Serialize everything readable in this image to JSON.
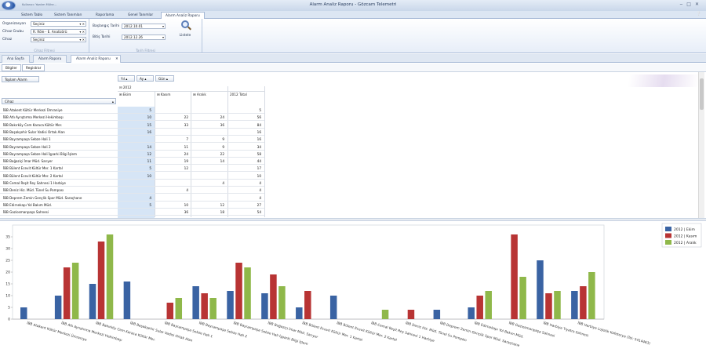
{
  "app": {
    "title": "Alarm Analiz Raporu - Gözcam Telemetri",
    "quick_access": "Kullanıcı: Yazılım Mühe..."
  },
  "ribbon_tabs": [
    "Sistem Tablo",
    "Sistem Tanımları",
    "Raporlama",
    "Genel Tanımlar",
    "Alarm Analiz Raporu"
  ],
  "filters": {
    "organization_label": "Organizasyon",
    "organization_value": "Seçiniz",
    "device_group_label": "Cihaz Grubu",
    "device_group_value": "R. Röle - E. Analizörü",
    "device_label": "Cihaz",
    "device_value": "Seçiniz",
    "group_caption": "Cihaz Filtresi"
  },
  "date_filters": {
    "start_label": "Başlangıç Tarihi",
    "start_value": "2012.10.01",
    "end_label": "Bitiş Tarihi",
    "end_value": "2012.12.26",
    "group_caption": "Tarih Filtresi"
  },
  "list_button": "Listele",
  "doc_tabs": [
    "Ana Sayfa",
    "Alarm Raporu",
    "Alarm Analiz Raporu"
  ],
  "sub_tabs": [
    "Bilgiler",
    "Registrar"
  ],
  "pivot": {
    "data_field": "Toplam Alarm",
    "column_fields": [
      "Yıl",
      "Ay",
      "Gün"
    ],
    "row_field": "Cihaz",
    "year": "2012",
    "months": [
      "Ekim",
      "Kasım",
      "Aralık"
    ],
    "total_label": "2012 Total",
    "rows": [
      {
        "name": "İBB Atakent Kültür Merkezi Ümraniye",
        "v": [
          "5",
          "",
          "",
          "5"
        ]
      },
      {
        "name": "İBB Atlı Ayrıştırma Merkezi Hekimbaşı",
        "v": [
          "10",
          "22",
          "24",
          "56"
        ]
      },
      {
        "name": "İBB Bakırköy Cem Karaca Kültür Mer.",
        "v": [
          "15",
          "33",
          "36",
          "84"
        ]
      },
      {
        "name": "İBB Başakşehir Sular Vadisi Ortak Alan",
        "v": [
          "16",
          "",
          "",
          "16"
        ]
      },
      {
        "name": "İBB Bayrampaşa Sebze Hali 1",
        "v": [
          "",
          "7",
          "9",
          "16"
        ]
      },
      {
        "name": "İBB Bayrampaşa Sebze Hali 2",
        "v": [
          "14",
          "11",
          "9",
          "34"
        ]
      },
      {
        "name": "İBB Bayrampaşa Sebze Hali İşparki Bilgi İşlem",
        "v": [
          "12",
          "24",
          "22",
          "58"
        ]
      },
      {
        "name": "İBB Boğaziçi İmar Müd. Sarıyer",
        "v": [
          "11",
          "19",
          "14",
          "44"
        ]
      },
      {
        "name": "İBB Bülent Ecevit Kültür Mer. 1 Kartal",
        "v": [
          "5",
          "12",
          "",
          "17"
        ]
      },
      {
        "name": "İBB Bülent Ecevit Kültür Mer. 2 Kartal",
        "v": [
          "10",
          "",
          "",
          "10"
        ]
      },
      {
        "name": "İBB Cemal Reşit Rey Sahnesi 1 Harbiye",
        "v": [
          "",
          "",
          "4",
          "4"
        ]
      },
      {
        "name": "İBB Deniz Hiz. Müd. Tünel Su Pompası",
        "v": [
          "",
          "4",
          "",
          "4"
        ]
      },
      {
        "name": "İBB Deprem Zemin Gençlik Spor Müd. Saraçhane",
        "v": [
          "4",
          "",
          "",
          "4"
        ]
      },
      {
        "name": "İBB Edirnekapı Yol Bakım Müd.",
        "v": [
          "5",
          "10",
          "12",
          "27"
        ]
      },
      {
        "name": "İBB Gaziosmanpaşa Sahnesi",
        "v": [
          "",
          "36",
          "18",
          "54"
        ]
      }
    ]
  },
  "chart_data": {
    "type": "bar",
    "title": "",
    "xlabel": "",
    "ylabel": "",
    "ylim": [
      0,
      40
    ],
    "yticks": [
      0,
      5,
      10,
      15,
      20,
      25,
      30,
      35
    ],
    "grid": false,
    "legend": "top-right",
    "categories": [
      "İBB Atakent Kültür Merkezi Ümraniye",
      "İBB Atlı Ayrıştırma Merkezi Hekimbaşı",
      "İBB Bakırköy Cem Karaca Kültür Mer.",
      "İBB Başakşehir Sular Vadisi Ortak Alan",
      "İBB Bayrampaşa Sebze Hali 1",
      "İBB Bayrampaşa Sebze Hali 2",
      "İBB Bayrampaşa Sebze Hali İşparki Bilgi İşlem",
      "İBB Boğaziçi İmar Müd. Sarıyer",
      "İBB Bülent Ecevit Kültür Mer. 1 Kartal",
      "İBB Bülent Ecevit Kültür Mer. 2 Kartal",
      "İBB Cemal Reşit Rey Sahnesi 1 Harbiye",
      "İBB Deniz Hiz. Müd. Tünel Su Pompası",
      "İBB Deprem Zemin Gençlik Spor Müd. Saraçhane",
      "İBB Edirnekapı Yol Bakım Müd.",
      "İBB Gaziosmanpaşa Sahnesi",
      "İBB Harbiye Tiyatro Sahnesi",
      "İBB Harbiye Lojistik Kafeterya (Tel: 5414463)"
    ],
    "series": [
      {
        "name": "2012 | Ekim",
        "color": "#3a63a3",
        "values": [
          5,
          10,
          15,
          16,
          0,
          14,
          12,
          11,
          5,
          10,
          0,
          0,
          4,
          5,
          0,
          25,
          12
        ]
      },
      {
        "name": "2012 | Kasım",
        "color": "#b83434",
        "values": [
          0,
          22,
          33,
          0,
          7,
          11,
          24,
          19,
          12,
          0,
          0,
          4,
          0,
          10,
          36,
          11,
          14
        ]
      },
      {
        "name": "2012 | Aralık",
        "color": "#8fb84a",
        "values": [
          0,
          24,
          36,
          0,
          9,
          9,
          22,
          14,
          0,
          0,
          4,
          0,
          0,
          12,
          18,
          12,
          20
        ]
      }
    ]
  }
}
